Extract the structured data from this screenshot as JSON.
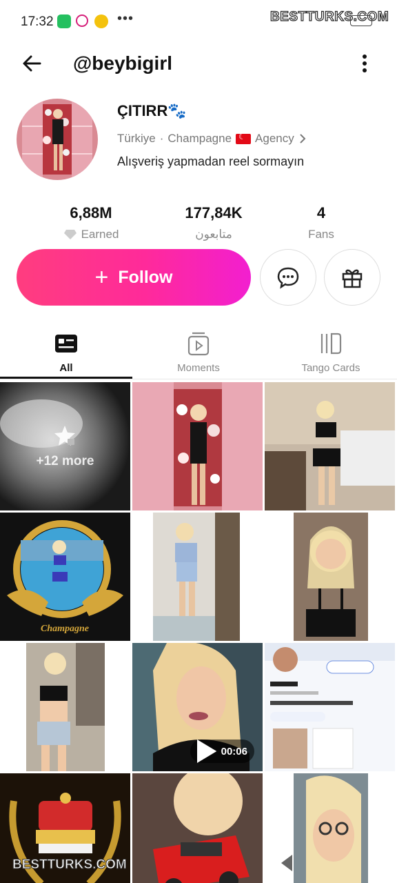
{
  "status_bar": {
    "time": "17:32",
    "dots": "•••",
    "watermark": "BESTTURKS.COM"
  },
  "header": {
    "username": "@beybigirl",
    "back_icon": "arrow-left-icon",
    "more_icon": "more-vertical-icon"
  },
  "profile": {
    "display_name": "ÇITIRR🐾",
    "country": "Türkiye",
    "separator": "·",
    "agency_prefix": "Champagne",
    "agency_suffix": "Agency",
    "bio": "Alışveriş yapmadan reel sormayın"
  },
  "stats": [
    {
      "value": "6,88M",
      "label": "Earned",
      "icon": "diamond-icon"
    },
    {
      "value": "177,84K",
      "label": "متابعون"
    },
    {
      "value": "4",
      "label": "Fans"
    }
  ],
  "actions": {
    "follow_label": "Follow",
    "follow_plus": "+",
    "accent_gradient": [
      "#ff3d7f",
      "#f21fd0"
    ]
  },
  "tabs": [
    {
      "label": "All",
      "icon": "id-card-icon",
      "active": true
    },
    {
      "label": "Moments",
      "icon": "play-frame-icon",
      "active": false
    },
    {
      "label": "Tango Cards",
      "icon": "cards-icon",
      "active": false
    }
  ],
  "grid": {
    "locked_label": "+12 more",
    "video_duration": "00:06",
    "watermark": "BESTTURKS.COM"
  }
}
